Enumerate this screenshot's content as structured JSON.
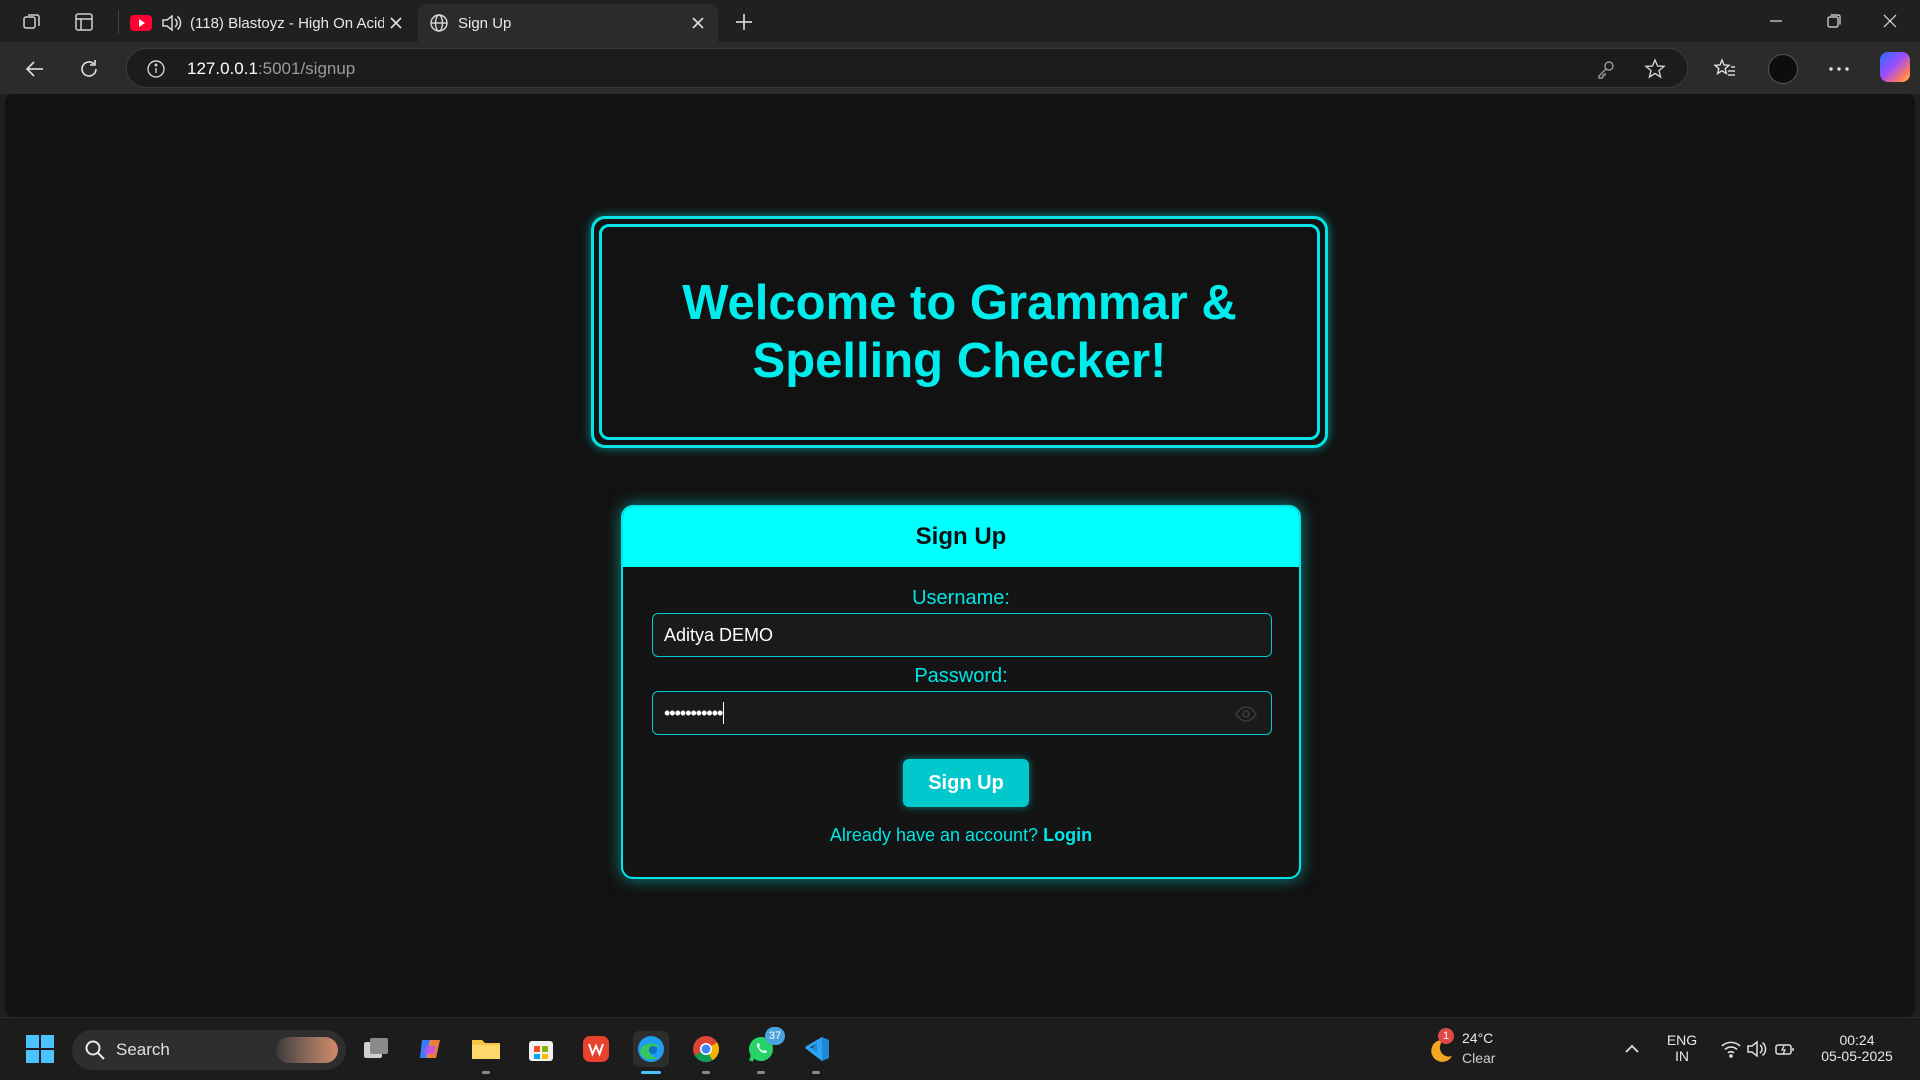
{
  "browser": {
    "tabs": [
      {
        "title": "(118) Blastoyz - High On Acid",
        "icon": "youtube-icon",
        "audio_icon": "speaker-icon"
      },
      {
        "title": "Sign Up",
        "icon": "globe-icon"
      }
    ],
    "url_host": "127.0.0.1",
    "url_rest": ":5001/signup"
  },
  "page": {
    "welcome_title": "Welcome to Grammar & Spelling Checker!",
    "form_title": "Sign Up",
    "username_label": "Username:",
    "username_value": "Aditya DEMO",
    "password_label": "Password:",
    "password_value": "•••••••••••",
    "submit_label": "Sign Up",
    "prompt_text": "Already have an account?",
    "login_link": "Login",
    "accent_color": "#00ffff"
  },
  "taskbar": {
    "search_label": "Search",
    "whatsapp_badge": "37",
    "weather_badge": "1",
    "weather_temp": "24°C",
    "weather_cond": "Clear",
    "lang_primary": "ENG",
    "lang_secondary": "IN",
    "time": "00:24",
    "date": "05-05-2025"
  }
}
